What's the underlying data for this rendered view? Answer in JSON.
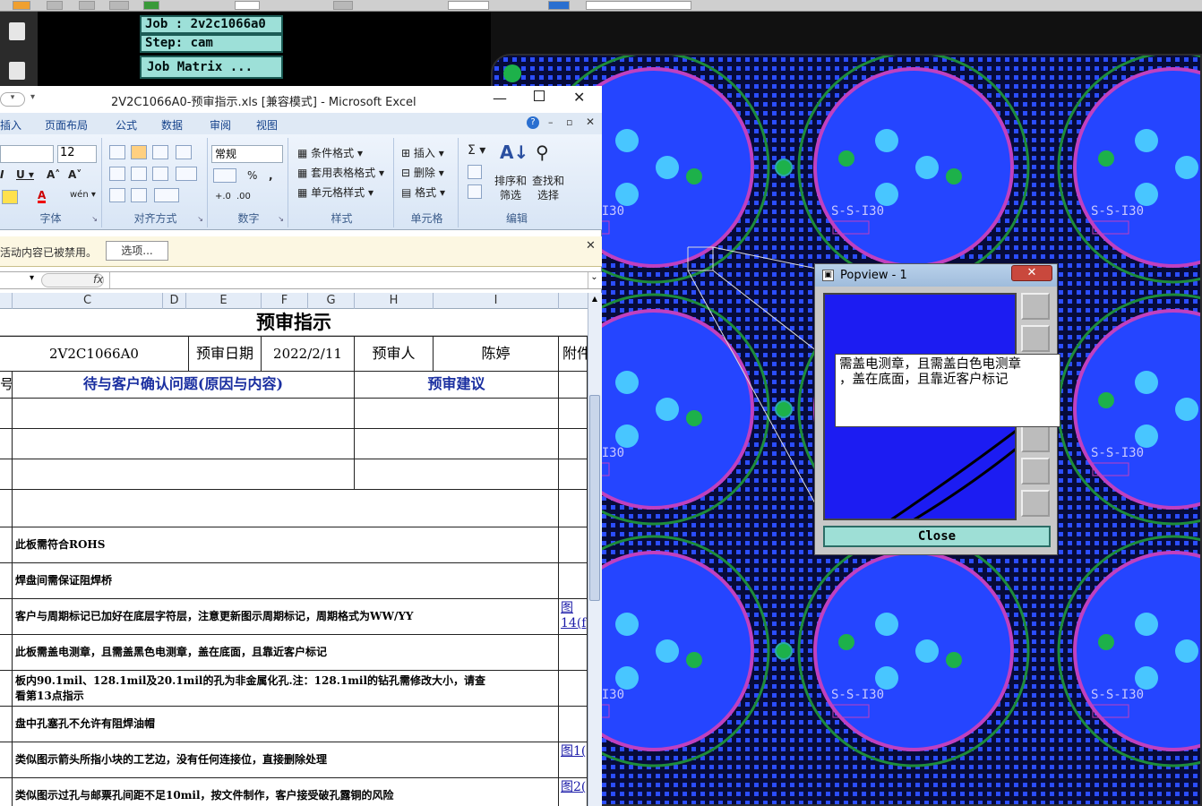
{
  "cam": {
    "job": "Job : 2v2c1066a0",
    "step": "Step: cam",
    "matrix_button": "Job Matrix ..."
  },
  "excel": {
    "title": "2V2C1066A0-预审指示.xls  [兼容模式] - Microsoft Excel",
    "tabs": [
      "插入",
      "页面布局",
      "公式",
      "数据",
      "审阅",
      "视图"
    ],
    "font_size": "12",
    "number_format": "常规",
    "groups": {
      "font": "字体",
      "align": "对齐方式",
      "number": "数字",
      "style": "样式",
      "cells": "单元格",
      "edit": "编辑"
    },
    "style_buttons": [
      "条件格式",
      "套用表格格式",
      "单元格样式"
    ],
    "cell_buttons": [
      "插入",
      "删除",
      "格式"
    ],
    "edit_buttons": [
      "排序和\n筛选",
      "查找和\n选择"
    ],
    "message": "活动内容已被禁用。",
    "options_button": "选项...",
    "fx": "fx",
    "columns": [
      "C",
      "D",
      "E",
      "F",
      "G",
      "H",
      "I"
    ],
    "sheet": {
      "title": "预审指示",
      "part_no": "2V2C1066A0",
      "date_label": "预审日期",
      "date": "2022/2/11",
      "reviewer_label": "预审人",
      "reviewer": "陈婷",
      "attach_label": "附件",
      "num_label": "号",
      "issue_header": "待与客户确认问题(原因与内容)",
      "suggest_header": "预审建议",
      "rows": [
        {
          "text": "此板需符合ROHS",
          "ref": ""
        },
        {
          "text": "焊盘间需保证阻焊桥",
          "ref": ""
        },
        {
          "text": "客户与周期标记已加好在底层字符层，注意更新图示周期标记，周期格式为WW/YY",
          "ref": "图\n14(f"
        },
        {
          "text": "此板需盖电测章，且需盖黑色电测章，盖在底面，且靠近客户标记",
          "ref": ""
        },
        {
          "text": "板内90.1mil、128.1mil及20.1mil的孔为非金属化孔.注：128.1mil的钻孔需修改大小，请查\n看第13点指示",
          "ref": ""
        },
        {
          "text": "盘中孔塞孔不允许有阻焊油帽",
          "ref": ""
        },
        {
          "text": "类似图示箭头所指小块的工艺边，没有任何连接位，直接删除处理",
          "ref": "图1("
        },
        {
          "text": "类似图示过孔与邮票孔间距不足10mil，按文件制作，客户接受破孔露铜的风险",
          "ref": "图2("
        }
      ]
    }
  },
  "pcb": {
    "silk_label": "S-S-I30",
    "board_color": "#1a237e",
    "pad_color": "#2b4dff",
    "ring_color": "#c040c0"
  },
  "popview": {
    "title": "Popview - 1",
    "close_x": "✕",
    "note": "需盖电测章，且需盖白色电测章\n，盖在底面，且靠近客户标记",
    "close_button": "Close"
  }
}
